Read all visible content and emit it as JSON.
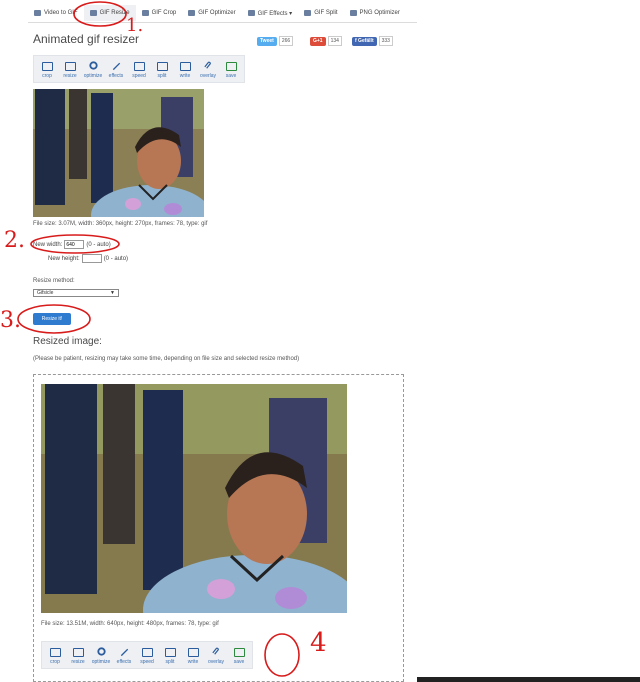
{
  "nav": {
    "tabs": [
      {
        "label": "Video to GIF"
      },
      {
        "label": "GIF Resize"
      },
      {
        "label": "GIF Crop"
      },
      {
        "label": "GIF Optimizer"
      },
      {
        "label": "GIF Effects ▾"
      },
      {
        "label": "GIF Split"
      },
      {
        "label": "PNG Optimizer"
      }
    ]
  },
  "page_title": "Animated gif resizer",
  "share": {
    "tweet_label": "Tweet",
    "tweet_count": "266",
    "gplus_label": "G+1",
    "gplus_count": "134",
    "fb_label": "f Gefällt",
    "fb_count": "333"
  },
  "toolbar": {
    "tools": [
      {
        "label": "crop"
      },
      {
        "label": "resize"
      },
      {
        "label": "optimize"
      },
      {
        "label": "effects"
      },
      {
        "label": "speed"
      },
      {
        "label": "split"
      },
      {
        "label": "write"
      },
      {
        "label": "overlay"
      },
      {
        "label": "save"
      }
    ]
  },
  "source_info": "File size: 3.07M, width: 360px, height: 270px, frames: 78, type: gif",
  "form": {
    "width_label": "New width:",
    "width_value": "640",
    "width_hint": "(0 - auto)",
    "height_label": "New height:",
    "height_value": "",
    "height_hint": "(0 - auto)",
    "method_label": "Resize method:",
    "method_value": "Gifsicle",
    "submit_label": "Resize it!"
  },
  "result": {
    "title": "Resized image:",
    "note": "(Please be patient, resizing may take some time, depending on file size and selected resize method)",
    "info": "File size: 13.51M, width: 640px, height: 480px, frames: 78, type: gif"
  },
  "annotations": {
    "n1": "1.",
    "n2": "2.",
    "n3": "3.",
    "n4": "4"
  },
  "colors": {
    "accent": "#2f7bd0",
    "annotation": "#d81b1b"
  }
}
